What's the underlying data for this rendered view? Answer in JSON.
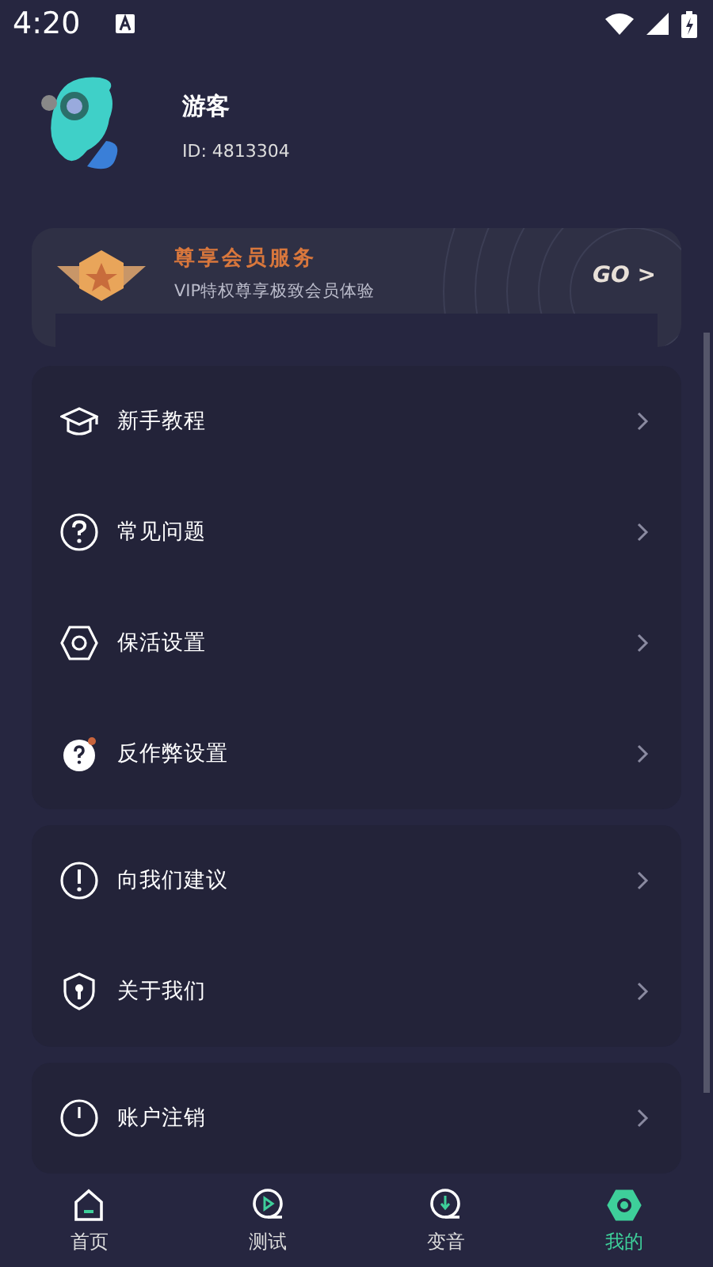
{
  "status_bar": {
    "time": "4:20"
  },
  "profile": {
    "name": "游客",
    "id": "ID: 4813304"
  },
  "vip_banner": {
    "title": "尊享会员服务",
    "subtitle": "VIP特权尊享极致会员体验",
    "action": "GO >"
  },
  "menu_groups": [
    {
      "items": [
        {
          "label": "新手教程",
          "kind": "cap"
        },
        {
          "label": "常见问题",
          "kind": "question"
        },
        {
          "label": "保活设置",
          "kind": "hex"
        },
        {
          "label": "反作弊设置",
          "kind": "question-filled"
        }
      ]
    },
    {
      "items": [
        {
          "label": "向我们建议",
          "kind": "exclaim"
        },
        {
          "label": "关于我们",
          "kind": "shield"
        }
      ]
    },
    {
      "items": [
        {
          "label": "账户注销",
          "kind": "power"
        }
      ]
    }
  ],
  "bottom_nav": [
    {
      "label": "首页",
      "kind": "home",
      "selected": false
    },
    {
      "label": "测试",
      "kind": "play",
      "selected": false
    },
    {
      "label": "变音",
      "kind": "mic",
      "selected": false
    },
    {
      "label": "我的",
      "kind": "hex",
      "selected": true
    }
  ]
}
